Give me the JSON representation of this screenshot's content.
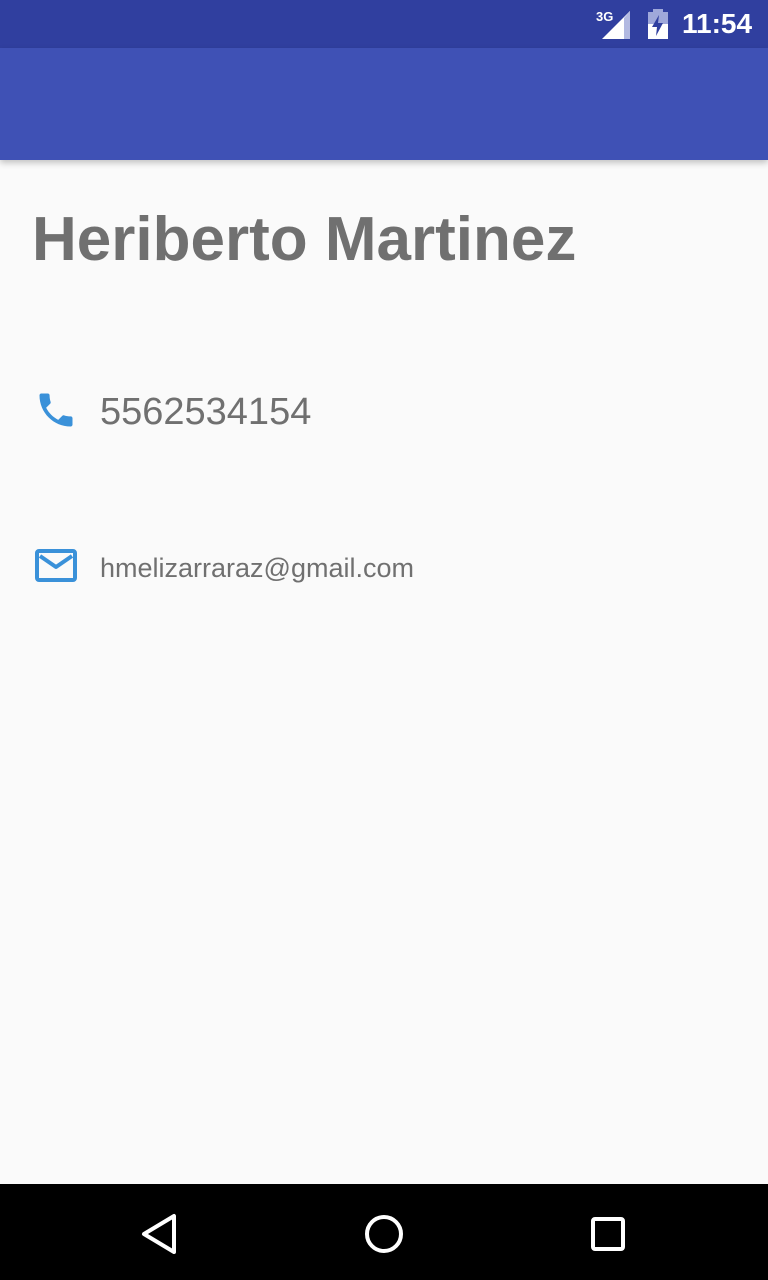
{
  "status_bar": {
    "network_label": "3G",
    "time": "11:54",
    "icons": [
      "signal-icon",
      "battery-charging-icon"
    ]
  },
  "app_bar": {
    "color": "#3f51b5"
  },
  "contact": {
    "name": "Heriberto Martinez",
    "phone": "5562534154",
    "email": "hmelizarraraz@gmail.com",
    "icon_color": "#3a91d9",
    "icons": [
      "phone-icon",
      "email-icon"
    ]
  },
  "nav_bar": {
    "icons": [
      "back-icon",
      "home-icon",
      "recents-icon"
    ]
  }
}
